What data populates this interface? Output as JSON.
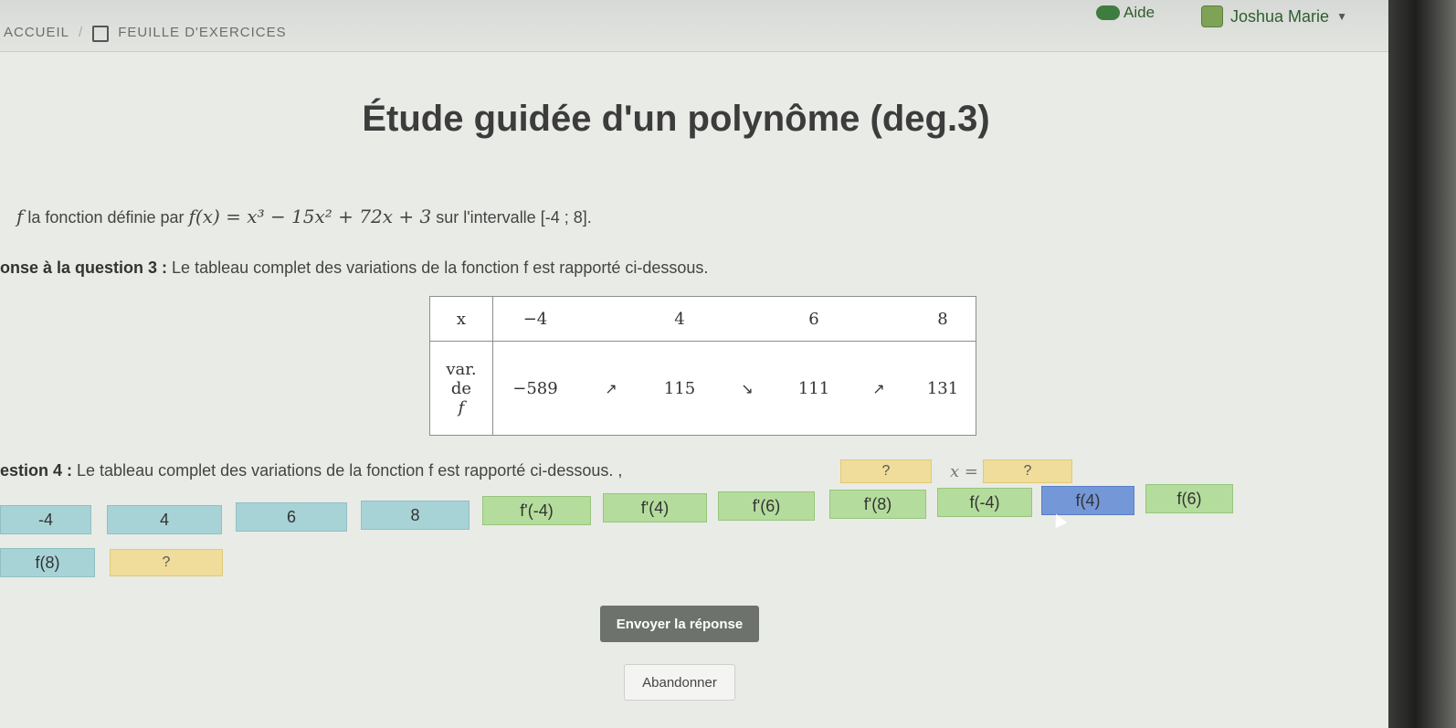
{
  "nav": {
    "home": "ACCUEIL",
    "separator": "/",
    "sheet": "FEUILLE D'EXERCICES",
    "help": "Aide",
    "user": "Joshua Marie"
  },
  "title": "Étude guidée d'un polynôme (deg.3)",
  "statement": {
    "f": "f",
    "text1": " la fonction définie par ",
    "formula": "f(x) = x³ − 15x² + 72x + 3",
    "text2": " sur l'intervalle [-4 ; 8]."
  },
  "answer3": {
    "label": "onse à la question 3 :",
    "text": " Le tableau complet des variations de la fonction f est rapporté ci-dessous."
  },
  "table": {
    "x_label": "x",
    "x_values": [
      "−4",
      "4",
      "6",
      "8"
    ],
    "var_label_1": "var.",
    "var_label_2": "de",
    "var_label_3": "f",
    "f_values": [
      "−589",
      "115",
      "111",
      "131"
    ],
    "arrows": [
      "↗",
      "↘",
      "↗"
    ]
  },
  "q4": {
    "label": "estion 4 :",
    "text": " Le tableau complet des variations de la fonction f est rapporté ci-dessous. ,",
    "slot1": "?",
    "x_eq": "x =",
    "slot2": "?"
  },
  "chips": [
    "-4",
    "4",
    "6",
    "8",
    "f'(-4)",
    "f'(4)",
    "f'(6)",
    "f'(8)",
    "f(-4)",
    "f(4)",
    "f(6)",
    "f(8)",
    "?"
  ],
  "buttons": {
    "submit": "Envoyer la réponse",
    "abort": "Abandonner"
  }
}
